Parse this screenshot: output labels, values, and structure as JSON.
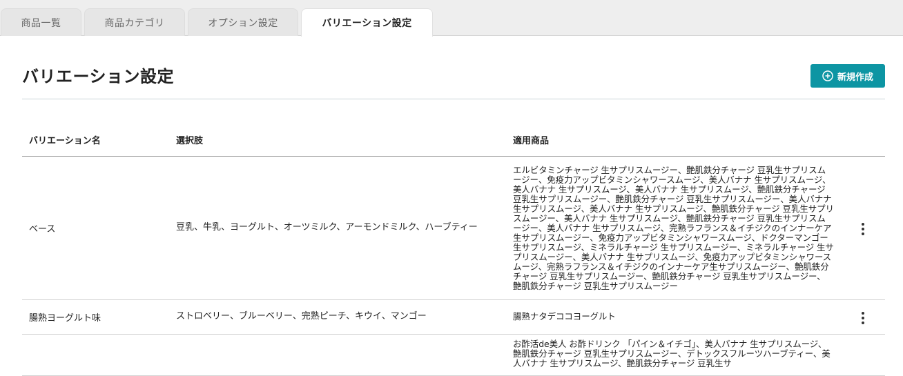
{
  "tabs": [
    {
      "label": "商品一覧"
    },
    {
      "label": "商品カテゴリ"
    },
    {
      "label": "オプション設定"
    },
    {
      "label": "バリエーション設定"
    }
  ],
  "page": {
    "title": "バリエーション設定",
    "new_button_label": "新規作成"
  },
  "table": {
    "headers": {
      "name": "バリエーション名",
      "options": "選択肢",
      "products": "適用商品"
    },
    "rows": [
      {
        "name": "ベース",
        "options": "豆乳、牛乳、ヨーグルト、オーツミルク、アーモンドミルク、ハーブティー",
        "products": "エルビタミンチャージ 生サプリスムージー、艶肌鉄分チャージ 豆乳生サプリスムージー、免疫力アップビタミンシャワースムージ、美人バナナ 生サプリスムージ、美人バナナ 生サプリスムージ、美人バナナ 生サプリスムージ、艶肌鉄分チャージ 豆乳生サプリスムージー、艶肌鉄分チャージ 豆乳生サプリスムージー、美人バナナ 生サプリスムージ、美人バナナ 生サプリスムージ、艶肌鉄分チャージ 豆乳生サプリスムージー、美人バナナ 生サプリスムージ、艶肌鉄分チャージ 豆乳生サプリスムージー、美人バナナ 生サプリスムージ、完熟ラフランス＆イチジクのインナーケア生サプリスムージー、免疫力アップビタミンシャワースムージ、ドクターマンゴー 生サプリスムージ、ミネラルチャージ 生サプリスムージー、ミネラルチャージ 生サプリスムージー、美人バナナ 生サプリスムージ、免疫力アップビタミンシャワースムージ、完熟ラフランス＆イチジクのインナーケア生サプリスムージー、艶肌鉄分チャージ 豆乳生サプリスムージー、艶肌鉄分チャージ 豆乳生サプリスムージー、艶肌鉄分チャージ 豆乳生サプリスムージー"
      },
      {
        "name": "腸熟ヨーグルト味",
        "options": "ストロベリー、ブルーベリー、完熟ピーチ、キウイ、マンゴー",
        "products": "腸熟ナタデココヨーグルト"
      },
      {
        "name": "",
        "options": "",
        "products": "お酢活de美人 お酢ドリンク 「パイン＆イチゴ」、美人バナナ 生サプリスムージ、艶肌鉄分チャージ 豆乳生サプリスムージー、デトックスフルーツハーブティー、美人バナナ 生サプリスムージ、艶肌鉄分チャージ 豆乳生サ"
      }
    ]
  }
}
